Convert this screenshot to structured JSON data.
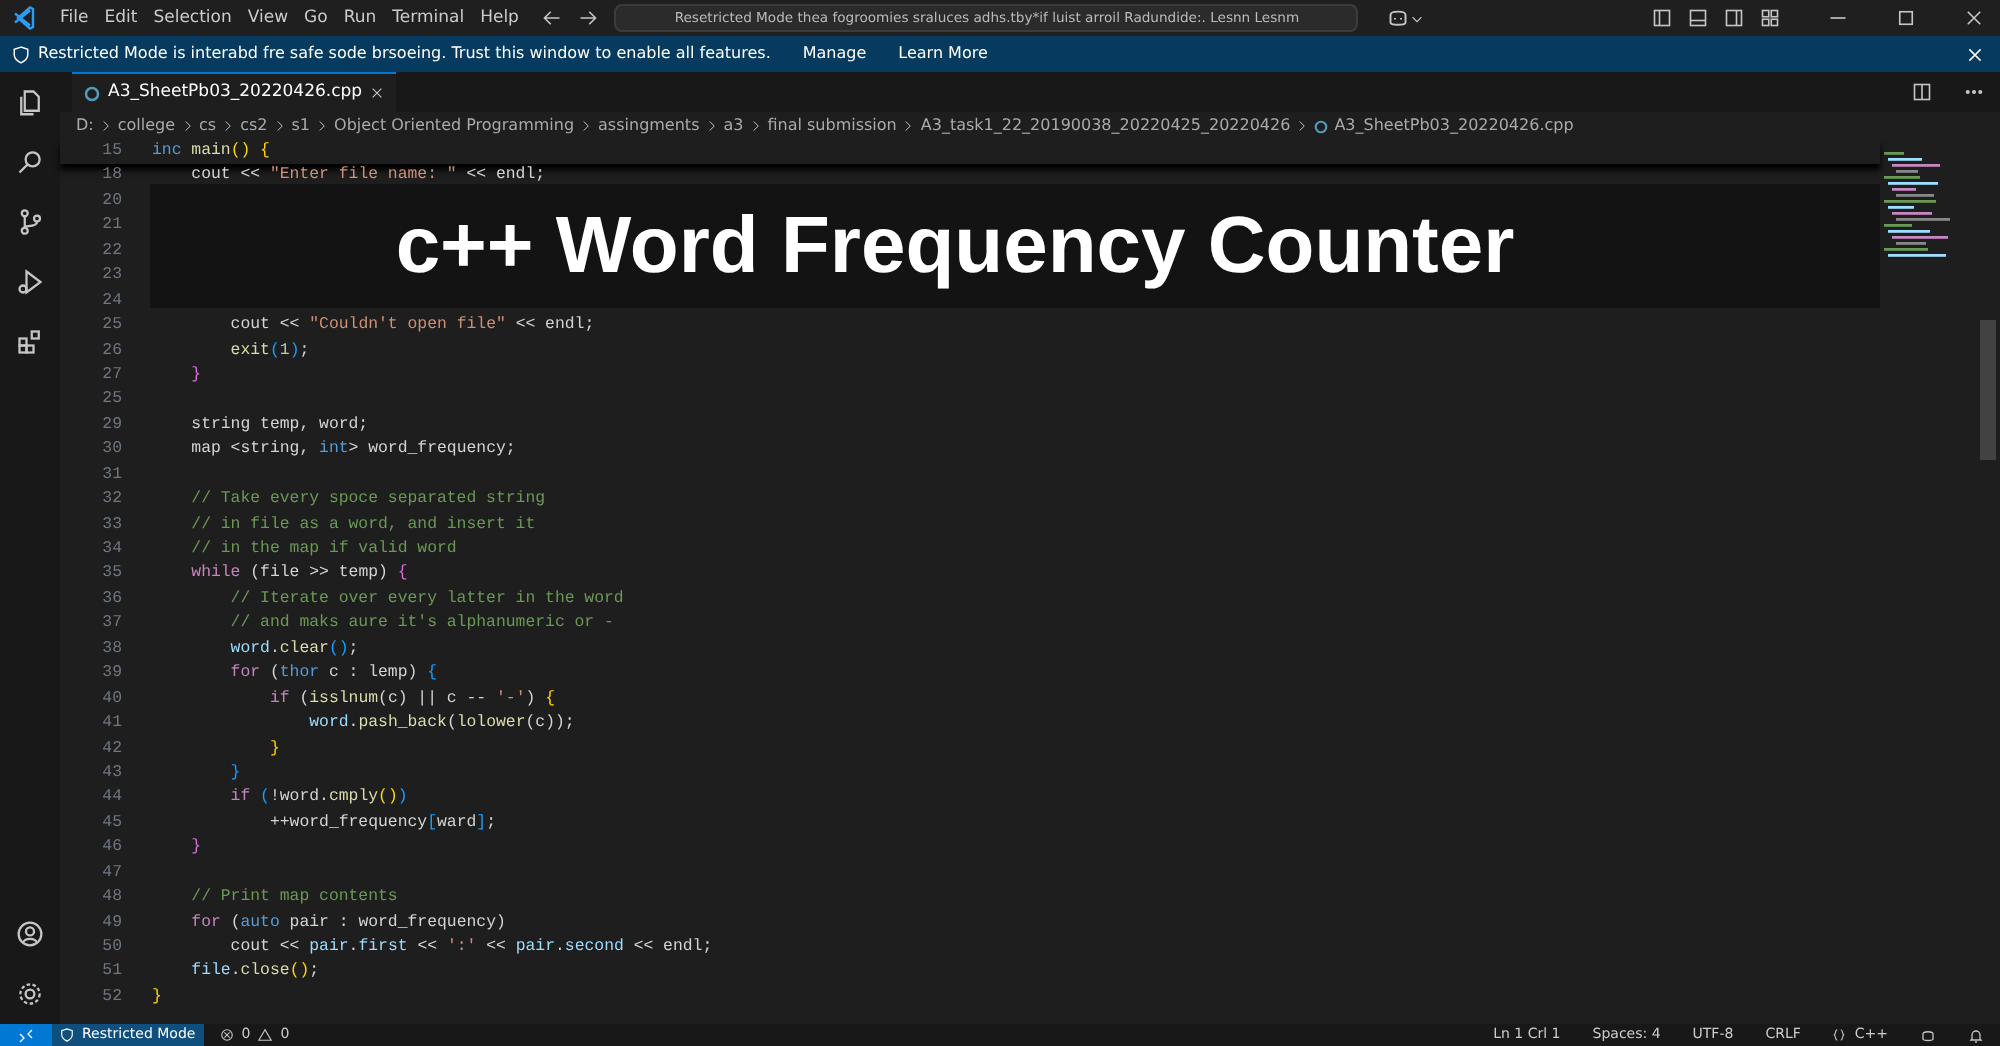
{
  "title_bar": {
    "menu": [
      "File",
      "Edit",
      "Selection",
      "View",
      "Go",
      "Run",
      "Terminal",
      "Help"
    ],
    "command_center": "Resetricted Mode thea fogroomies sraluces adhs.tby*if luist arroil Radundide:. Lesnn Lesnm"
  },
  "restricted_banner": {
    "message": "Restricted Mode is interabd fre safe sode brsoeing. Trust this window to enable all features.",
    "links": [
      "Manage",
      "Learn More"
    ]
  },
  "tabs": [
    {
      "label": "A3_SheetPb03_20220426.cpp",
      "selected": true
    }
  ],
  "breadcrumb": [
    "D:",
    "college",
    "cs",
    "cs2",
    "s1",
    "Object Oriented Programming",
    "assingments",
    "a3",
    "final submission",
    "A3_task1_22_20190038_20220425_20220426",
    "A3_SheetPb03_20220426.cpp"
  ],
  "editor": {
    "sticky_line": {
      "number": "15",
      "tokens": [
        {
          "kind": "type",
          "text": "inc "
        },
        {
          "kind": "fn",
          "text": "main"
        },
        {
          "kind": "br1",
          "text": "() {"
        }
      ]
    },
    "lines": [
      {
        "number": "18",
        "tokens": [
          {
            "kind": "plain",
            "text": "    cout << "
          },
          {
            "kind": "str",
            "text": "\"Enter file name: \""
          },
          {
            "kind": "plain",
            "text": " << endl;"
          }
        ]
      },
      {
        "number": "20"
      },
      {
        "number": "21"
      },
      {
        "number": "22"
      },
      {
        "number": "23"
      },
      {
        "number": "24"
      },
      {
        "number": "25",
        "tokens": [
          {
            "kind": "plain",
            "text": "        cout << "
          },
          {
            "kind": "str",
            "text": "\"Couldn't open file\""
          },
          {
            "kind": "plain",
            "text": " << endl;"
          }
        ]
      },
      {
        "number": "26",
        "tokens": [
          {
            "kind": "fn",
            "text": "        exit"
          },
          {
            "kind": "br3",
            "text": "("
          },
          {
            "kind": "num",
            "text": "1"
          },
          {
            "kind": "br3",
            "text": ")"
          },
          {
            "kind": "plain",
            "text": ";"
          }
        ]
      },
      {
        "number": "27",
        "tokens": [
          {
            "kind": "br2",
            "text": "    }"
          }
        ]
      },
      {
        "number": "25"
      },
      {
        "number": "29",
        "tokens": [
          {
            "kind": "plain",
            "text": "    string temp, word;"
          }
        ]
      },
      {
        "number": "30",
        "tokens": [
          {
            "kind": "plain",
            "text": "    map <string, "
          },
          {
            "kind": "type",
            "text": "int"
          },
          {
            "kind": "plain",
            "text": "> word_frequency;"
          }
        ]
      },
      {
        "number": "31"
      },
      {
        "number": "32",
        "tokens": [
          {
            "kind": "cmt",
            "text": "    // Take every spoce separated string"
          }
        ]
      },
      {
        "number": "33",
        "tokens": [
          {
            "kind": "cmt",
            "text": "    // in file as a word, and insert it"
          }
        ]
      },
      {
        "number": "34",
        "tokens": [
          {
            "kind": "cmt",
            "text": "    // in the map if valid word"
          }
        ]
      },
      {
        "number": "35",
        "tokens": [
          {
            "kind": "kw",
            "text": "    while"
          },
          {
            "kind": "plain",
            "text": " (file >> temp) "
          },
          {
            "kind": "br2",
            "text": "{"
          }
        ]
      },
      {
        "number": "36",
        "tokens": [
          {
            "kind": "cmt",
            "text": "        // Iterate over every latter in the word"
          }
        ]
      },
      {
        "number": "37",
        "tokens": [
          {
            "kind": "cmt",
            "text": "        // and maks aure it's alphanumeric or -"
          }
        ]
      },
      {
        "number": "38",
        "tokens": [
          {
            "kind": "var",
            "text": "        word"
          },
          {
            "kind": "plain",
            "text": "."
          },
          {
            "kind": "fn",
            "text": "clear"
          },
          {
            "kind": "br3",
            "text": "()"
          },
          {
            "kind": "plain",
            "text": ";"
          }
        ]
      },
      {
        "number": "39",
        "tokens": [
          {
            "kind": "kw",
            "text": "        for"
          },
          {
            "kind": "plain",
            "text": " ("
          },
          {
            "kind": "type",
            "text": "thor"
          },
          {
            "kind": "plain",
            "text": " c : lemp) "
          },
          {
            "kind": "br3",
            "text": "{"
          }
        ]
      },
      {
        "number": "40",
        "tokens": [
          {
            "kind": "kw",
            "text": "            if"
          },
          {
            "kind": "plain",
            "text": " ("
          },
          {
            "kind": "fn",
            "text": "isslnum"
          },
          {
            "kind": "plain",
            "text": "(c) || c -- "
          },
          {
            "kind": "str",
            "text": "'-'"
          },
          {
            "kind": "plain",
            "text": ") "
          },
          {
            "kind": "br1",
            "text": "{"
          }
        ]
      },
      {
        "number": "41",
        "tokens": [
          {
            "kind": "var",
            "text": "                word"
          },
          {
            "kind": "plain",
            "text": "."
          },
          {
            "kind": "fn",
            "text": "pash_back"
          },
          {
            "kind": "plain",
            "text": "("
          },
          {
            "kind": "fn",
            "text": "lolower"
          },
          {
            "kind": "plain",
            "text": "(c));"
          }
        ]
      },
      {
        "number": "42",
        "tokens": [
          {
            "kind": "br1",
            "text": "            }"
          }
        ]
      },
      {
        "number": "43",
        "tokens": [
          {
            "kind": "br3",
            "text": "        }"
          }
        ]
      },
      {
        "number": "44",
        "tokens": [
          {
            "kind": "kw",
            "text": "        if"
          },
          {
            "kind": "br3",
            "text": " ("
          },
          {
            "kind": "plain",
            "text": "!word."
          },
          {
            "kind": "fn",
            "text": "cmply"
          },
          {
            "kind": "br1",
            "text": "()"
          },
          {
            "kind": "br3",
            "text": ")"
          }
        ]
      },
      {
        "number": "45",
        "tokens": [
          {
            "kind": "plain",
            "text": "            ++word_frequency"
          },
          {
            "kind": "br3",
            "text": "["
          },
          {
            "kind": "plain",
            "text": "ward"
          },
          {
            "kind": "br3",
            "text": "]"
          },
          {
            "kind": "plain",
            "text": ";"
          }
        ]
      },
      {
        "number": "46",
        "tokens": [
          {
            "kind": "br2",
            "text": "    }"
          }
        ]
      },
      {
        "number": "47"
      },
      {
        "number": "48",
        "tokens": [
          {
            "kind": "cmt",
            "text": "    // Print map contents"
          }
        ]
      },
      {
        "number": "49",
        "tokens": [
          {
            "kind": "kw",
            "text": "    for"
          },
          {
            "kind": "plain",
            "text": " ("
          },
          {
            "kind": "type",
            "text": "auto"
          },
          {
            "kind": "plain",
            "text": " pair : word_frequency)"
          }
        ]
      },
      {
        "number": "50",
        "tokens": [
          {
            "kind": "plain",
            "text": "        cout << "
          },
          {
            "kind": "var",
            "text": "pair"
          },
          {
            "kind": "plain",
            "text": "."
          },
          {
            "kind": "var",
            "text": "first"
          },
          {
            "kind": "plain",
            "text": " << "
          },
          {
            "kind": "str",
            "text": "':'"
          },
          {
            "kind": "plain",
            "text": " << "
          },
          {
            "kind": "var",
            "text": "pair"
          },
          {
            "kind": "plain",
            "text": "."
          },
          {
            "kind": "var",
            "text": "second"
          },
          {
            "kind": "plain",
            "text": " << endl;"
          }
        ]
      },
      {
        "number": "51",
        "tokens": [
          {
            "kind": "var",
            "text": "    file"
          },
          {
            "kind": "plain",
            "text": "."
          },
          {
            "kind": "fn",
            "text": "close"
          },
          {
            "kind": "br1",
            "text": "()"
          },
          {
            "kind": "plain",
            "text": ";"
          }
        ]
      },
      {
        "number": "52",
        "tokens": [
          {
            "kind": "br1",
            "text": "}"
          }
        ]
      }
    ]
  },
  "overlay_title": "c++ Word Frequency Counter",
  "status_bar": {
    "mode": "Restricted Mode",
    "errors": "0",
    "warnings": "0",
    "position": "Ln 1 Crl 1",
    "spaces": "Spaces: 4",
    "encoding": "UTF-8",
    "eol": "CRLF",
    "language": "C++"
  }
}
